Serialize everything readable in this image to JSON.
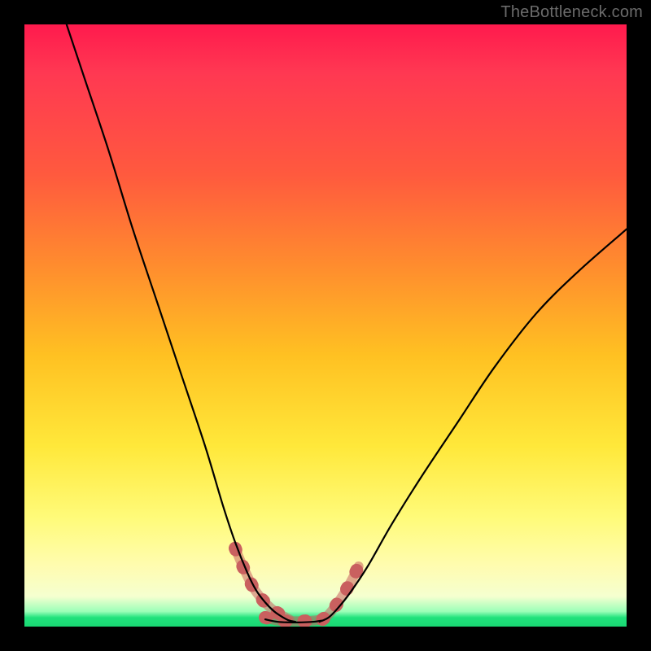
{
  "watermark": "TheBottleneck.com",
  "chart_data": {
    "type": "line",
    "title": "",
    "xlabel": "",
    "ylabel": "",
    "xlim": [
      0,
      100
    ],
    "ylim": [
      0,
      100
    ],
    "grid": false,
    "legend": false,
    "series": [
      {
        "name": "left-curve",
        "x": [
          7,
          10,
          14,
          18,
          22,
          26,
          30,
          33,
          35,
          37,
          38.5,
          40,
          41.5,
          43,
          44,
          45
        ],
        "y": [
          100,
          91,
          79,
          66,
          54,
          42,
          30,
          20,
          14,
          9,
          6,
          4,
          2.5,
          1.5,
          1,
          0.8
        ]
      },
      {
        "name": "right-curve",
        "x": [
          49,
          50.5,
          52,
          54,
          57,
          61,
          66,
          72,
          78,
          85,
          92,
          100
        ],
        "y": [
          0.8,
          1.5,
          3,
          5.5,
          10,
          17,
          25,
          34,
          43,
          52,
          59,
          66
        ]
      },
      {
        "name": "bottom-flat",
        "x": [
          40,
          42,
          44,
          46,
          48,
          49.5
        ],
        "y": [
          1.2,
          0.8,
          0.7,
          0.7,
          0.8,
          1.0
        ]
      }
    ],
    "highlight_segments": [
      {
        "name": "left-lower-highlight",
        "x": [
          35,
          36.5,
          38,
          39.5,
          41,
          42.5,
          44
        ],
        "y": [
          13,
          9.5,
          6.5,
          4.5,
          3,
          2,
          1.2
        ]
      },
      {
        "name": "bottom-highlight",
        "x": [
          40,
          42,
          44,
          46,
          48,
          49.5
        ],
        "y": [
          1.5,
          1.0,
          0.9,
          0.9,
          1.0,
          1.2
        ]
      },
      {
        "name": "right-lower-highlight",
        "x": [
          49.5,
          50.5,
          51.5,
          52.5,
          53.5,
          54.5,
          55.5
        ],
        "y": [
          1.2,
          2.0,
          3.2,
          4.6,
          6.2,
          8.0,
          10.0
        ]
      }
    ],
    "colors": {
      "curve_stroke": "#000000",
      "highlight_stroke": "#c9605f",
      "frame": "#000000"
    }
  }
}
